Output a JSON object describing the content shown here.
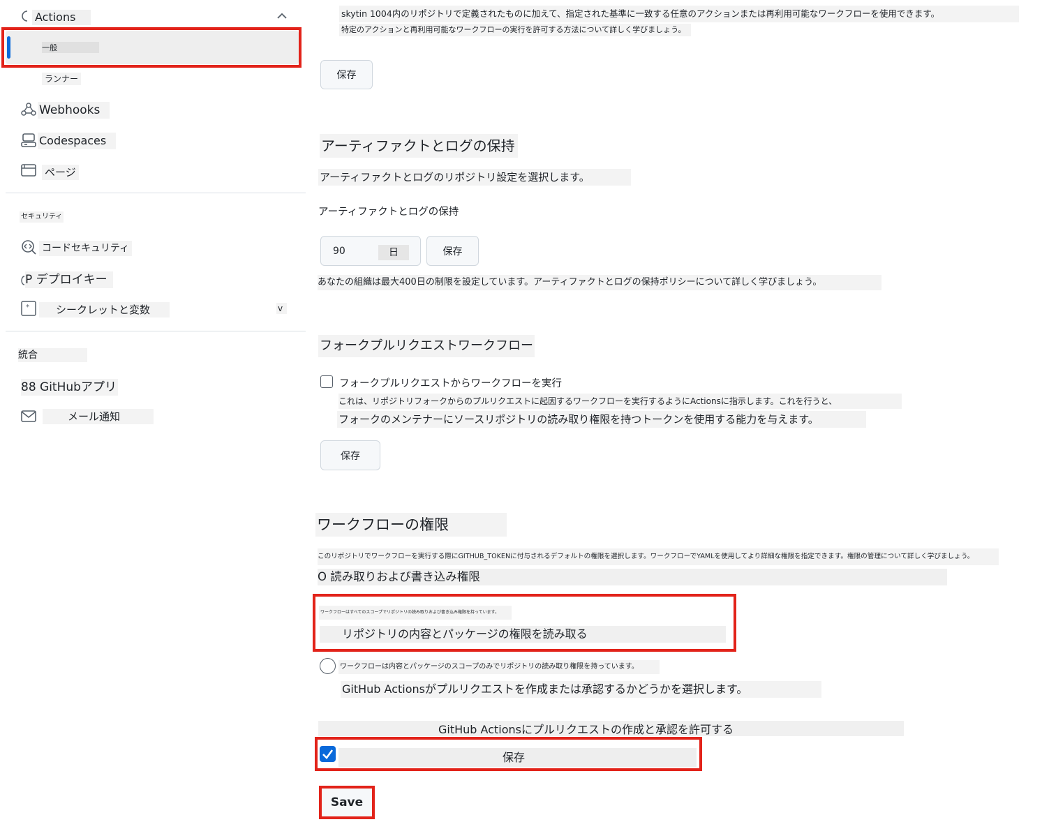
{
  "sidebar": {
    "actions_label": "Actions",
    "general_label": "一般",
    "runners_label": "ランナー",
    "webhooks_label": "Webhooks",
    "codespaces_label": "Codespaces",
    "pages_label": "ページ",
    "security_heading": "セキュリティ",
    "code_security_label": "コードセキュリティ",
    "deploy_keys_label": "P デプロイキー",
    "secrets_label": "シークレットと変数",
    "secrets_chevron": "v",
    "integrations_heading": "統合",
    "github_apps_label": "88 GitHubアプリ",
    "email_label": "メール通知"
  },
  "main": {
    "policy_text": "skytin 1004内のリポジトリで定義されたものに加えて、指定された基準に一致する任意のアクションまたは再利用可能なワークフローを使用できます。",
    "policy_learn": "特定のアクションと再利用可能なワークフローの実行を許可する方法について詳しく学びましょう。",
    "policy_save": "保存",
    "artifact_title": "アーティファクトとログの保持",
    "artifact_desc": "アーティファクトとログのリポジトリ設定を選択します。",
    "artifact_field_label": "アーティファクトとログの保持",
    "artifact_days_value": "90",
    "artifact_days_unit": "日",
    "artifact_save": "保存",
    "artifact_note": "あなたの組織は最大400日の制限を設定しています。アーティファクトとログの保持ポリシーについて詳しく学びましょう。",
    "fork_title": "フォークプルリクエストワークフロー",
    "fork_checkbox_label": "フォークプルリクエストからワークフローを実行",
    "fork_desc1": "これは、リポジトリフォークからのプルリクエストに起因するワークフローを実行するようにActionsに指示します。これを行うと、",
    "fork_desc2": "フォークのメンテナーにソースリポジトリの読み取り権限を持つトークンを使用する能力を与えます。",
    "fork_save": "保存",
    "perm_title": "ワークフローの権限",
    "perm_desc": "このリポジトリでワークフローを実行する際にGITHUB_TOKENに付与されるデフォルトの権限を選択します。ワークフローでYAMLを使用してより詳細な権限を指定できます。権限の管理について詳しく学びましょう。",
    "perm_rw_label": "O 読み取りおよび書き込み権限",
    "perm_rw_desc": "ワークフローはすべてのスコープでリポジトリの読み取りおよび書き込み権限を持っています。",
    "perm_read_label": "リポジトリの内容とパッケージの権限を読み取る",
    "perm_read_desc": "ワークフローは内容とパッケージのスコープのみでリポジトリの読み取り権限を持っています。",
    "pr_desc": "GitHub Actionsがプルリクエストを作成または承認するかどうかを選択します。",
    "pr_allow_label": "GitHub Actionsにプルリクエストの作成と承認を許可する",
    "pr_save_label": "保存",
    "final_save": "Save"
  },
  "colors": {
    "highlight_red": "#e2231a",
    "checkbox_blue": "#0969da",
    "nav_active_blue": "#0969da"
  }
}
